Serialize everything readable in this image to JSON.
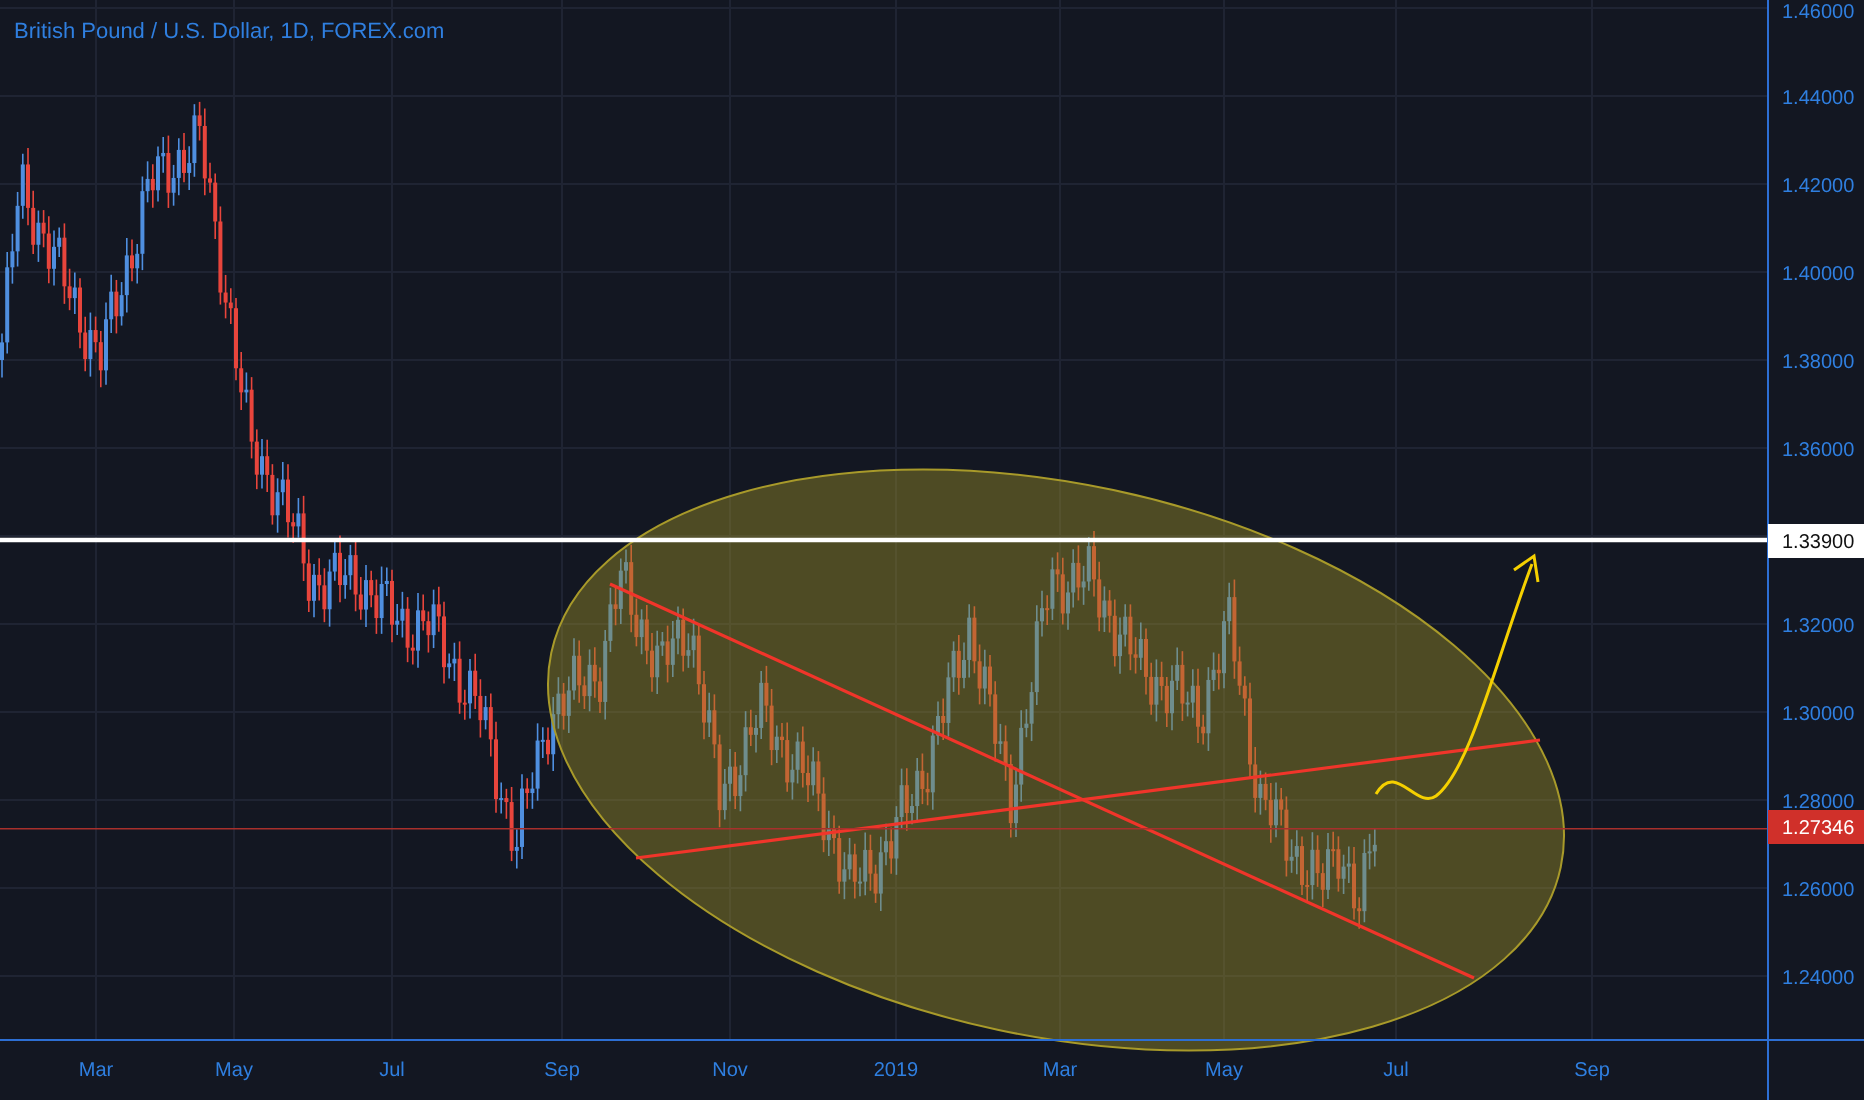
{
  "chart": {
    "title": "British Pound / U.S. Dollar, 1D, FOREX.com",
    "price_axis": [
      "1.46000",
      "1.44000",
      "1.42000",
      "1.40000",
      "1.38000",
      "1.36000",
      "1.32000",
      "1.30000",
      "1.28000",
      "1.26000",
      "1.24000"
    ],
    "time_axis": [
      "Mar",
      "May",
      "Jul",
      "Sep",
      "Nov",
      "2019",
      "Mar",
      "May",
      "Jul",
      "Sep"
    ],
    "level_line_label": "1.33900",
    "last_price_label": "1.27346"
  }
}
